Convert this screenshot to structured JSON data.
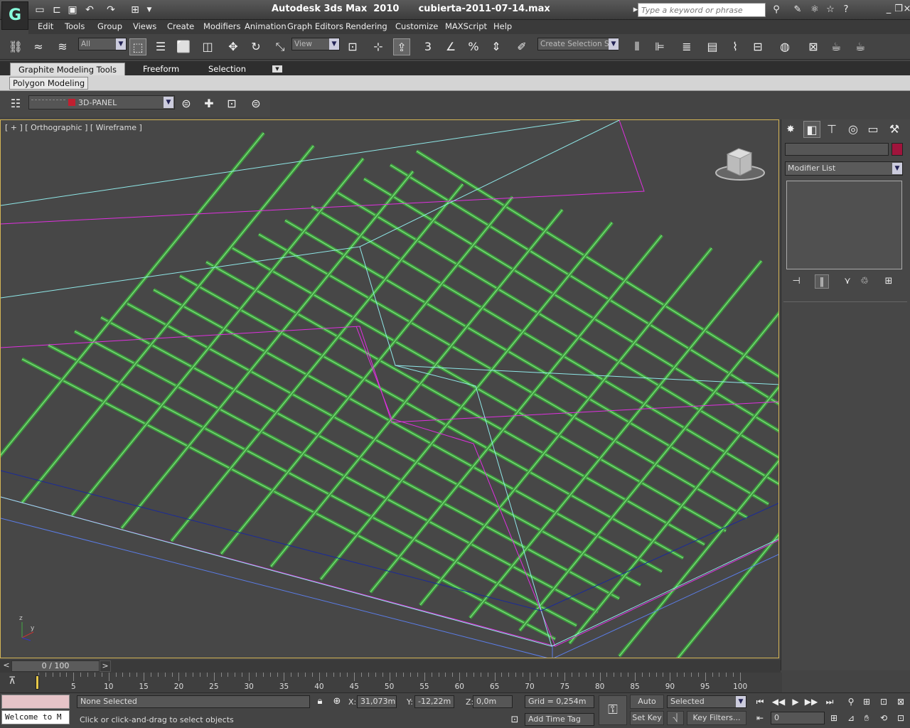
{
  "app": {
    "logo": "G",
    "title": "Autodesk 3ds Max  2010      cubierta-2011-07-14.max",
    "search_placeholder": "Type a keyword or phrase"
  },
  "menu": [
    "Edit",
    "Tools",
    "Group",
    "Views",
    "Create",
    "Modifiers",
    "Animation",
    "Graph Editors",
    "Rendering",
    "Customize",
    "MAXScript",
    "Help"
  ],
  "toolbar": {
    "filter": "All",
    "ref_coord": "View",
    "selection_set": "Create Selection Se"
  },
  "ribbon": {
    "tabs": [
      "Graphite Modeling Tools",
      "Freeform",
      "Selection"
    ],
    "subtab": "Polygon Modeling",
    "object_name": "3D-PANEL"
  },
  "viewport": {
    "label": "[ + ] [ Orthographic ] [ Wireframe ]",
    "axis": {
      "z": "z",
      "y": "y"
    }
  },
  "command_panel": {
    "modifier_list": "Modifier List",
    "object_color": "#a0143c"
  },
  "timeline": {
    "slider": "0 / 100",
    "ticks": [
      "5",
      "10",
      "15",
      "20",
      "25",
      "30",
      "35",
      "40",
      "45",
      "50",
      "55",
      "60",
      "65",
      "70",
      "75",
      "80",
      "85",
      "90",
      "95",
      "100"
    ]
  },
  "status": {
    "welcome": "Welcome to M",
    "selection": "None Selected",
    "prompt": "Click or click-and-drag to select objects",
    "x_label": "X:",
    "x": "31,073m",
    "y_label": "Y:",
    "y": "-12,22m",
    "z_label": "Z:",
    "z": "0,0m",
    "grid": "Grid = 0,254m",
    "add_time_tag": "Add Time Tag",
    "auto_key": "Auto Key",
    "set_key": "Set Key",
    "key_mode": "Selected",
    "key_filters": "Key Filters...",
    "frame": "0"
  }
}
